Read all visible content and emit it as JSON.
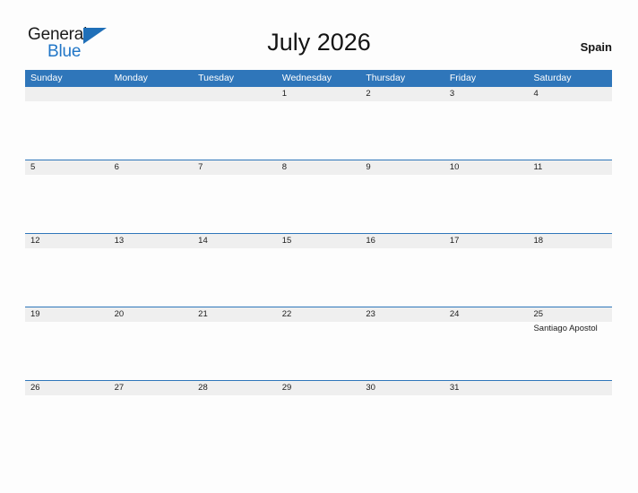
{
  "brand": {
    "name_part1": "General",
    "name_part2": "Blue",
    "flag_icon": "blue-flag-icon"
  },
  "header": {
    "title": "July 2026",
    "region": "Spain"
  },
  "calendar": {
    "month": "July",
    "year": "2026",
    "weekday_headers": [
      "Sunday",
      "Monday",
      "Tuesday",
      "Wednesday",
      "Thursday",
      "Friday",
      "Saturday"
    ],
    "colors": {
      "header_blue": "#2f76ba",
      "date_band_gray": "#efefef",
      "page_background": "#fdfdfd",
      "logo_blue": "#2176c7",
      "text": "#1c1c1c"
    },
    "weeks": [
      {
        "days": [
          {
            "date": "",
            "events": []
          },
          {
            "date": "",
            "events": []
          },
          {
            "date": "",
            "events": []
          },
          {
            "date": "1",
            "events": []
          },
          {
            "date": "2",
            "events": []
          },
          {
            "date": "3",
            "events": []
          },
          {
            "date": "4",
            "events": []
          }
        ]
      },
      {
        "days": [
          {
            "date": "5",
            "events": []
          },
          {
            "date": "6",
            "events": []
          },
          {
            "date": "7",
            "events": []
          },
          {
            "date": "8",
            "events": []
          },
          {
            "date": "9",
            "events": []
          },
          {
            "date": "10",
            "events": []
          },
          {
            "date": "11",
            "events": []
          }
        ]
      },
      {
        "days": [
          {
            "date": "12",
            "events": []
          },
          {
            "date": "13",
            "events": []
          },
          {
            "date": "14",
            "events": []
          },
          {
            "date": "15",
            "events": []
          },
          {
            "date": "16",
            "events": []
          },
          {
            "date": "17",
            "events": []
          },
          {
            "date": "18",
            "events": []
          }
        ]
      },
      {
        "days": [
          {
            "date": "19",
            "events": []
          },
          {
            "date": "20",
            "events": []
          },
          {
            "date": "21",
            "events": []
          },
          {
            "date": "22",
            "events": []
          },
          {
            "date": "23",
            "events": []
          },
          {
            "date": "24",
            "events": []
          },
          {
            "date": "25",
            "events": [
              "Santiago Apostol"
            ]
          }
        ]
      },
      {
        "days": [
          {
            "date": "26",
            "events": []
          },
          {
            "date": "27",
            "events": []
          },
          {
            "date": "28",
            "events": []
          },
          {
            "date": "29",
            "events": []
          },
          {
            "date": "30",
            "events": []
          },
          {
            "date": "31",
            "events": []
          },
          {
            "date": "",
            "events": []
          }
        ]
      }
    ]
  }
}
